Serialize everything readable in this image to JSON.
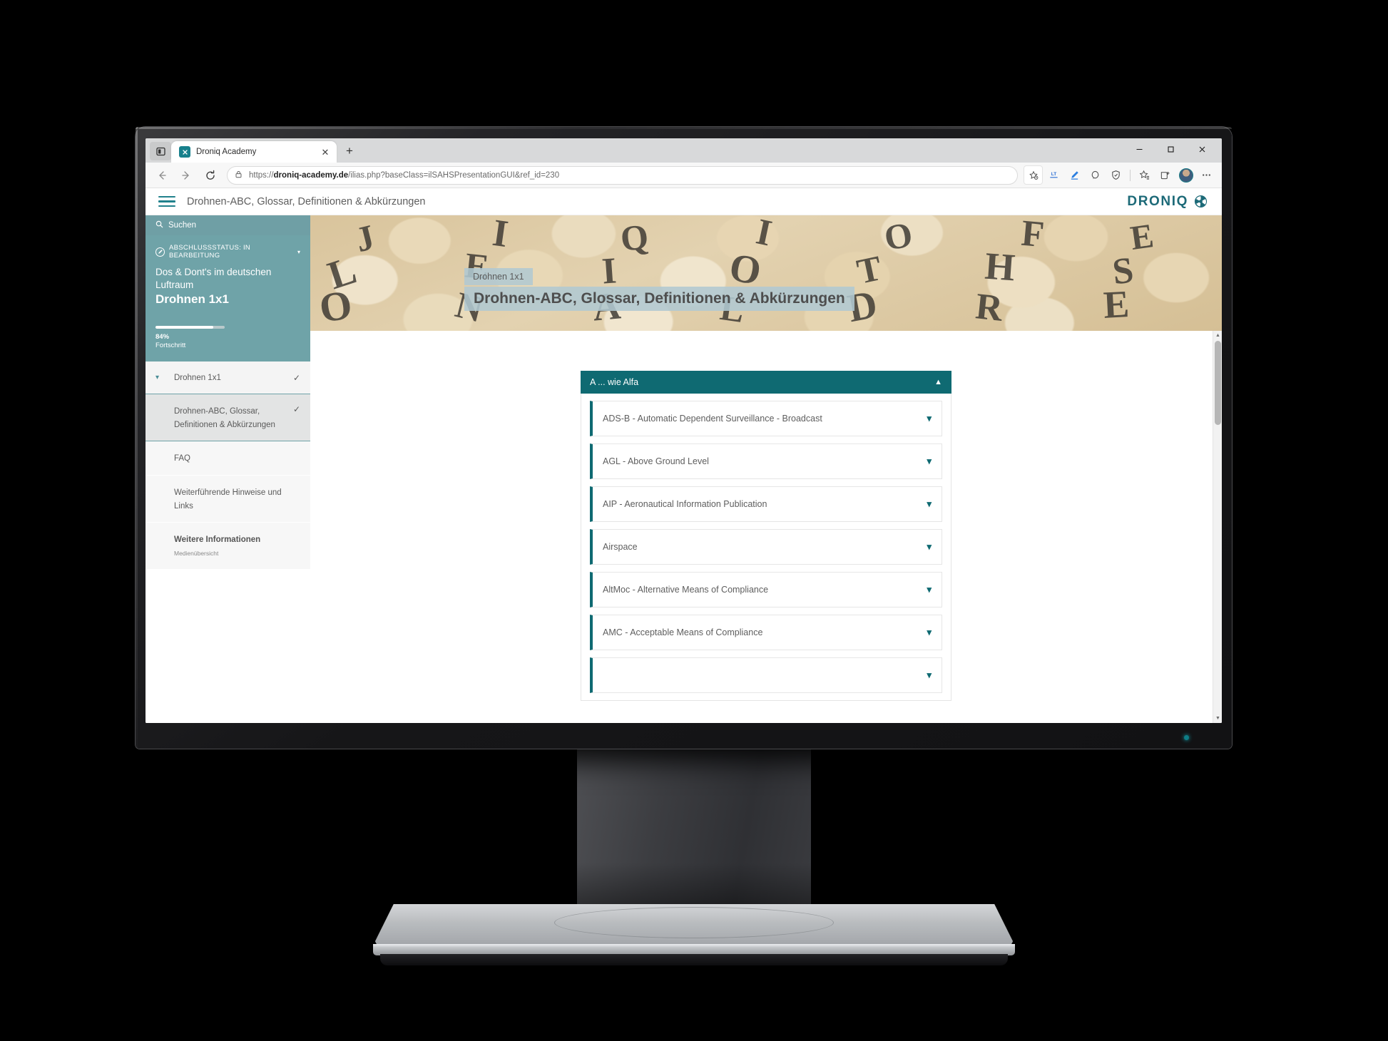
{
  "browser": {
    "tab": {
      "title": "Droniq Academy",
      "favicon": "droniq-favicon",
      "close_label": "✕"
    },
    "new_tab_label": "+",
    "window_controls": {
      "minimize": "minimize-icon",
      "maximize": "maximize-icon",
      "close": "close-icon"
    },
    "nav": {
      "back": "back-arrow-icon",
      "forward": "forward-arrow-icon",
      "reload": "reload-icon"
    },
    "omnibox": {
      "lock": "lock-icon",
      "url_prefix": "https://",
      "url_host": "droniq-academy.de",
      "url_path": "/ilias.php?baseClass=ilSAHSPresentationGUI&ref_id=230",
      "url_full": "https://droniq-academy.de/ilias.php?baseClass=ilSAHSPresentationGUI&ref_id=230"
    },
    "toolbar_icons": [
      "favorite-add-icon",
      "lastpass-icon",
      "highlighter-icon",
      "read-aloud-icon",
      "shield-icon",
      "collections-icon",
      "browser-essentials-icon",
      "profile-avatar",
      "more-options-icon"
    ]
  },
  "site": {
    "header": {
      "menu_icon": "hamburger-menu-icon",
      "title": "Drohnen-ABC, Glossar, Definitionen & Abkürzungen",
      "brand_name": "DRONIQ",
      "brand_mark": "droniq-logo-mark"
    }
  },
  "sidebar": {
    "search": {
      "icon": "search-icon",
      "label": "Suchen"
    },
    "status": {
      "icon": "edit-status-icon",
      "text": "ABSCHLUSSSTATUS: IN BEARBEITUNG",
      "caret": "chevron-down-icon"
    },
    "course": {
      "subtitle": "Dos & Dont's im deutschen Luftraum",
      "title": "Drohnen 1x1"
    },
    "progress": {
      "percent": "84%",
      "value": 84,
      "label": "Fortschritt"
    },
    "nav_items": [
      {
        "label": "Drohnen 1x1",
        "sub": "",
        "caret": "chevron-down-icon",
        "check": "✓",
        "state": "expanded-parent"
      },
      {
        "label": "Drohnen-ABC, Glossar, Definitionen & Abkürzungen",
        "sub": "",
        "caret": "",
        "check": "✓",
        "state": "active"
      },
      {
        "label": "FAQ",
        "sub": "",
        "caret": "",
        "check": "",
        "state": "normal"
      },
      {
        "label": "Weiterführende Hinweise und Links",
        "sub": "",
        "caret": "",
        "check": "",
        "state": "normal"
      },
      {
        "label": "Weitere Informationen",
        "sub": "Medienübersicht",
        "caret": "",
        "check": "",
        "state": "normal"
      }
    ]
  },
  "hero": {
    "kicker": "Drohnen 1x1",
    "headline": "Drohnen-ABC, Glossar, Definitionen & Abkürzungen",
    "image_alt": "wooden-letter-tiles-photo"
  },
  "content": {
    "group": {
      "title": "A ... wie Alfa",
      "caret": "chevron-up-icon",
      "expanded": true
    },
    "items": [
      {
        "label": "ADS-B - Automatic Dependent Surveillance - Broadcast",
        "caret": "chevron-down-icon"
      },
      {
        "label": "AGL - Above Ground Level",
        "caret": "chevron-down-icon"
      },
      {
        "label": "AIP - Aeronautical Information Publication",
        "caret": "chevron-down-icon"
      },
      {
        "label": "Airspace",
        "caret": "chevron-down-icon"
      },
      {
        "label": "AltMoc - Alternative Means of Compliance",
        "caret": "chevron-down-icon"
      },
      {
        "label": "AMC - Acceptable Means of Compliance",
        "caret": "chevron-down-icon"
      },
      {
        "label": "",
        "caret": "chevron-down-icon"
      }
    ]
  },
  "colors": {
    "brand_teal": "#1d6a78",
    "accent_teal": "#0f6a72",
    "sidebar_teal": "#6fa3a8",
    "hero_overlay": "#b0c8d1"
  },
  "hardware": {
    "device": "desktop-monitor",
    "power_led": "power-led-indicator"
  }
}
